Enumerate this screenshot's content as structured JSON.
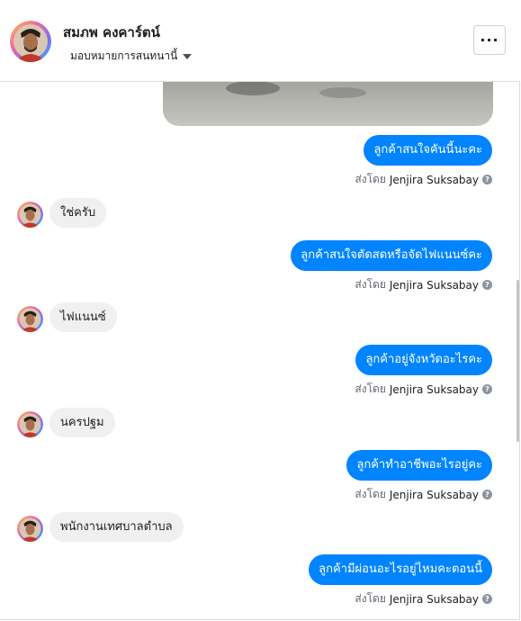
{
  "header": {
    "contact_name": "สมภพ คงคาร์ตน์",
    "assign_label": "มอบหมายการสนทนานี้",
    "more_label": "···"
  },
  "sent_by": {
    "prefix": "ส่งโดย",
    "agent_name": "Jenjira Suksabay"
  },
  "messages": [
    {
      "from": "agent",
      "text": "ลูกค้าสนใจคันนี้นะคะ"
    },
    {
      "from": "contact",
      "text": "ใช่ครับ"
    },
    {
      "from": "agent",
      "text": "ลูกค้าสนใจตัดสดหรือจัดไฟแนนซ์คะ"
    },
    {
      "from": "contact",
      "text": "ไฟแนนซ์"
    },
    {
      "from": "agent",
      "text": "ลูกค้าอยู่จังหวัดอะไรคะ"
    },
    {
      "from": "contact",
      "text": "นครปฐม"
    },
    {
      "from": "agent",
      "text": "ลูกค้าทำอาชีพอะไรอยู่คะ"
    },
    {
      "from": "contact",
      "text": "พนักงานเทศบาลตำบล"
    },
    {
      "from": "agent",
      "text": "ลูกค้ามีผ่อนอะไรอยู่ไหมคะตอนนี้"
    }
  ],
  "colors": {
    "outgoing_bubble": "#0084ff",
    "incoming_bubble": "#f0f0f0",
    "meta_text": "#606770"
  },
  "icons": {
    "avatar": "avatar-photo",
    "assign_caret": "caret-down-icon",
    "more": "more-dots-icon",
    "help": "question-circle-icon"
  }
}
